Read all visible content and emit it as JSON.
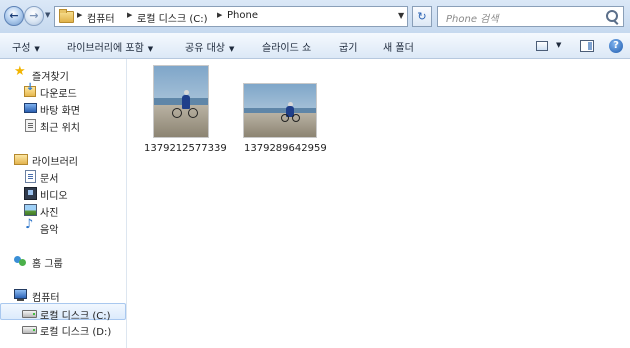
{
  "address_bar": {
    "breadcrumbs": [
      "컴퓨터",
      "로컬 디스크 (C:)",
      "Phone"
    ],
    "search_placeholder": "Phone 검색"
  },
  "toolbar": {
    "items": [
      {
        "label": "구성",
        "has_dropdown": true
      },
      {
        "label": "라이브러리에 포함",
        "has_dropdown": true
      },
      {
        "label": "공유 대상",
        "has_dropdown": true
      },
      {
        "label": "슬라이드 쇼",
        "has_dropdown": false
      },
      {
        "label": "굽기",
        "has_dropdown": false
      },
      {
        "label": "새 폴더",
        "has_dropdown": false
      }
    ],
    "icons": [
      "change-view-icon",
      "preview-pane-icon",
      "help-icon"
    ]
  },
  "sidebar": {
    "favorites": {
      "label": "즐겨찾기",
      "items": [
        "다운로드",
        "바탕 화면",
        "최근 위치"
      ]
    },
    "libraries": {
      "label": "라이브러리",
      "items": [
        "문서",
        "비디오",
        "사진",
        "음악"
      ]
    },
    "homegroup": {
      "label": "홈 그룹"
    },
    "computer": {
      "label": "컴퓨터",
      "items": [
        {
          "label": "로컬 디스크 (C:)",
          "selected": true
        },
        {
          "label": "로컬 디스크 (D:)",
          "selected": false
        }
      ]
    }
  },
  "files": [
    {
      "name": "1379212577339",
      "orientation": "portrait"
    },
    {
      "name": "1379289642959",
      "orientation": "landscape"
    }
  ],
  "colors": {
    "accent": "#2a62b3",
    "selection_bg": "#dcebfc",
    "selection_border": "#a9c8ef"
  }
}
